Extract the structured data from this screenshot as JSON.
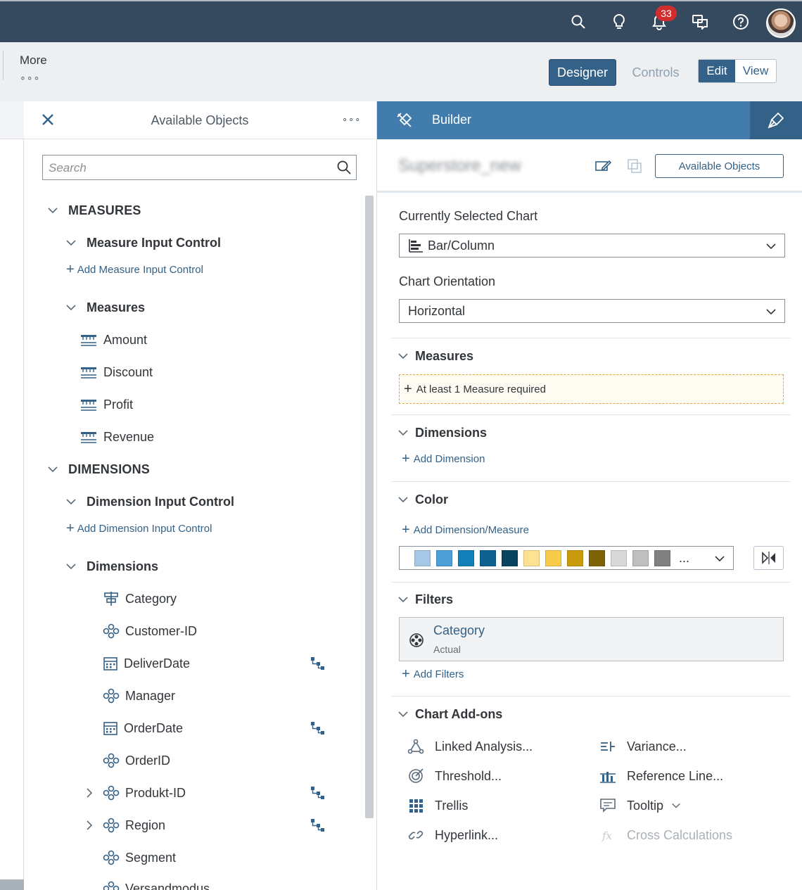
{
  "shell": {
    "notification_count": "33",
    "icons": [
      "search-icon",
      "lightbulb-icon",
      "bell-icon",
      "chat-icon",
      "help-icon"
    ]
  },
  "subbar": {
    "more_label": "More",
    "more_dots": "∘∘∘",
    "designer_label": "Designer",
    "controls_label": "Controls",
    "edit_label": "Edit",
    "view_label": "View"
  },
  "available_objects": {
    "title": "Available Objects",
    "more": "∘∘∘",
    "search_placeholder": "Search",
    "measures_section": "MEASURES",
    "measure_input_control": "Measure Input Control",
    "add_measure_input_control": "Add Measure Input Control",
    "measures_group": "Measures",
    "measures": [
      {
        "label": "Amount"
      },
      {
        "label": "Discount"
      },
      {
        "label": "Profit"
      },
      {
        "label": "Revenue"
      }
    ],
    "dimensions_section": "DIMENSIONS",
    "dimension_input_control": "Dimension Input Control",
    "add_dimension_input_control": "Add Dimension Input Control",
    "dimensions_group": "Dimensions",
    "dimensions": [
      {
        "label": "Category",
        "icon": "category-icon"
      },
      {
        "label": "Customer-ID",
        "icon": "dimension-icon"
      },
      {
        "label": "DeliverDate",
        "icon": "calendar-icon",
        "hierarchy": true
      },
      {
        "label": "Manager",
        "icon": "dimension-icon"
      },
      {
        "label": "OrderDate",
        "icon": "calendar-icon",
        "hierarchy": true
      },
      {
        "label": "OrderID",
        "icon": "dimension-icon"
      },
      {
        "label": "Produkt-ID",
        "icon": "dimension-icon",
        "hierarchy": true,
        "expandable": true
      },
      {
        "label": "Region",
        "icon": "dimension-icon",
        "hierarchy": true,
        "expandable": true
      },
      {
        "label": "Segment",
        "icon": "dimension-icon"
      },
      {
        "label": "Versandmodus",
        "icon": "dimension-icon"
      }
    ]
  },
  "builder": {
    "title": "Builder",
    "chart_name": "Superstore_new",
    "available_objects_button": "Available Objects",
    "currently_selected_chart_label": "Currently Selected Chart",
    "currently_selected_chart_value": "Bar/Column",
    "chart_orientation_label": "Chart Orientation",
    "chart_orientation_value": "Horizontal",
    "measures_title": "Measures",
    "measure_required": "At least 1 Measure required",
    "dimensions_title": "Dimensions",
    "add_dimension": "Add Dimension",
    "color_title": "Color",
    "add_dimension_measure": "Add Dimension/Measure",
    "palette": [
      "#a6c8e6",
      "#4d9fd8",
      "#1180b8",
      "#0d628f",
      "#08435f",
      "#fde294",
      "#f8cc4a",
      "#c99a0a",
      "#7e6207",
      "#d9d9d9",
      "#bfbfbf",
      "#808080"
    ],
    "palette_more": "...",
    "filters_title": "Filters",
    "filter_name": "Category",
    "filter_sub": "Actual",
    "add_filters": "Add Filters",
    "addons_title": "Chart Add-ons",
    "addons_left": [
      {
        "label": "Linked Analysis...",
        "icon": "linked-analysis-icon"
      },
      {
        "label": "Threshold...",
        "icon": "threshold-icon"
      },
      {
        "label": "Trellis",
        "icon": "trellis-icon"
      },
      {
        "label": "Hyperlink...",
        "icon": "hyperlink-icon"
      }
    ],
    "addons_right": [
      {
        "label": "Variance...",
        "icon": "variance-icon"
      },
      {
        "label": "Reference Line...",
        "icon": "reference-line-icon"
      },
      {
        "label": "Tooltip",
        "icon": "tooltip-icon"
      },
      {
        "label": "Cross Calculations",
        "icon": "cross-calculations-icon",
        "disabled": true
      }
    ]
  }
}
